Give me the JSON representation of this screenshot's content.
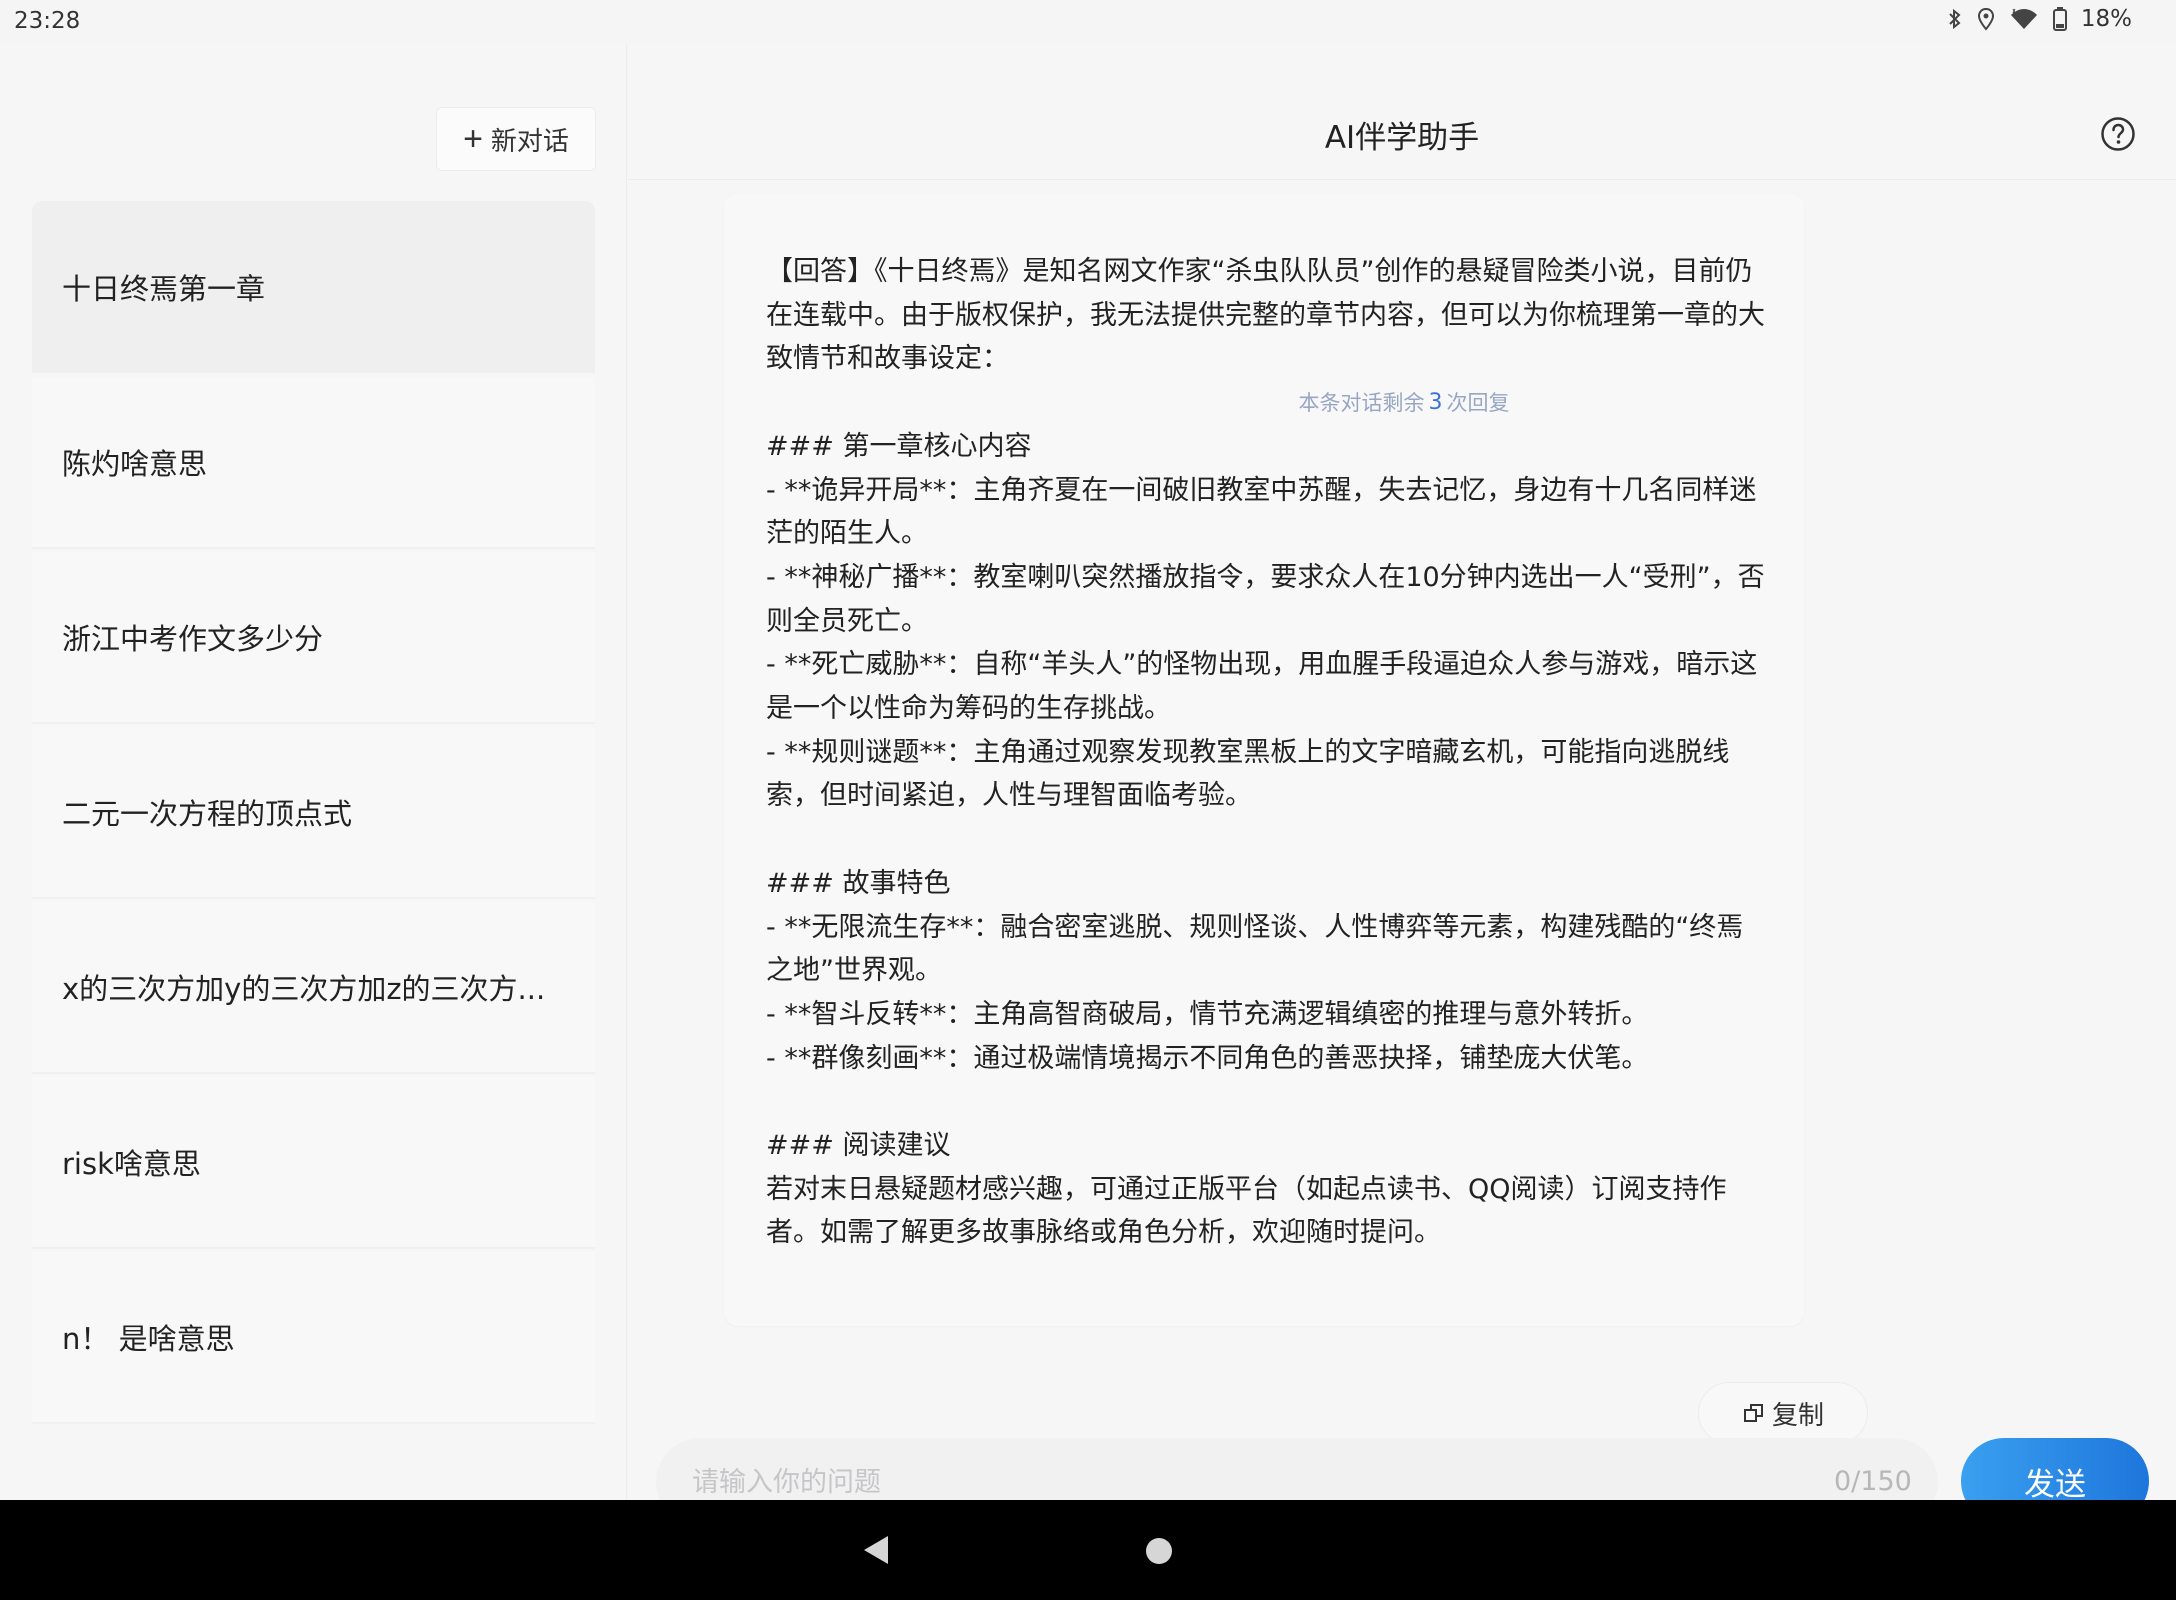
{
  "status_bar": {
    "time": "23:28",
    "battery": "18%",
    "icons": [
      "bluetooth-icon",
      "location-icon",
      "wifi-icon",
      "battery-icon"
    ]
  },
  "sidebar": {
    "new_chat_label": "新对话",
    "items": [
      {
        "label": "十日终焉第一章",
        "active": true
      },
      {
        "label": "陈灼啥意思"
      },
      {
        "label": "浙江中考作文多少分"
      },
      {
        "label": "二元一次方程的顶点式"
      },
      {
        "label": "x的三次方加y的三次方加z的三次方..."
      },
      {
        "label": "risk啥意思"
      },
      {
        "label": "n！ 是啥意思"
      }
    ]
  },
  "header": {
    "title": "AI伴学助手",
    "help_icon": "help-circle-icon"
  },
  "answer": {
    "text": "【回答】《十日终焉》是知名网文作家“杀虫队队员”创作的悬疑冒险类小说，目前仍在连载中。由于版权保护，我无法提供完整的章节内容，但可以为你梳理第一章的大致情节和故事设定：\n\n### 第一章核心内容\n- **诡异开局**：主角齐夏在一间破旧教室中苏醒，失去记忆，身边有十几名同样迷茫的陌生人。\n- **神秘广播**：教室喇叭突然播放指令，要求众人在10分钟内选出一人“受刑”，否则全员死亡。\n- **死亡威胁**：自称“羊头人”的怪物出现，用血腥手段逼迫众人参与游戏，暗示这是一个以性命为筹码的生存挑战。\n- **规则谜题**：主角通过观察发现教室黑板上的文字暗藏玄机，可能指向逃脱线索，但时间紧迫，人性与理智面临考验。\n\n### 故事特色\n- **无限流生存**：融合密室逃脱、规则怪谈、人性博弈等元素，构建残酷的“终焉之地”世界观。\n- **智斗反转**：主角高智商破局，情节充满逻辑缜密的推理与意外转折。\n- **群像刻画**：通过极端情境揭示不同角色的善恶抉择，铺垫庞大伏笔。\n\n### 阅读建议\n若对末日悬疑题材感兴趣，可通过正版平台（如起点读书、QQ阅读）订阅支持作者。如需了解更多故事脉络或角色分析，欢迎随时提问。",
    "copy_label": "复制",
    "remaining_prefix": "本条对话剩余",
    "remaining_count": "3",
    "remaining_suffix": "次回复"
  },
  "input": {
    "placeholder": "请输入你的问题",
    "value": "",
    "counter": "0/150",
    "send_label": "发送"
  }
}
